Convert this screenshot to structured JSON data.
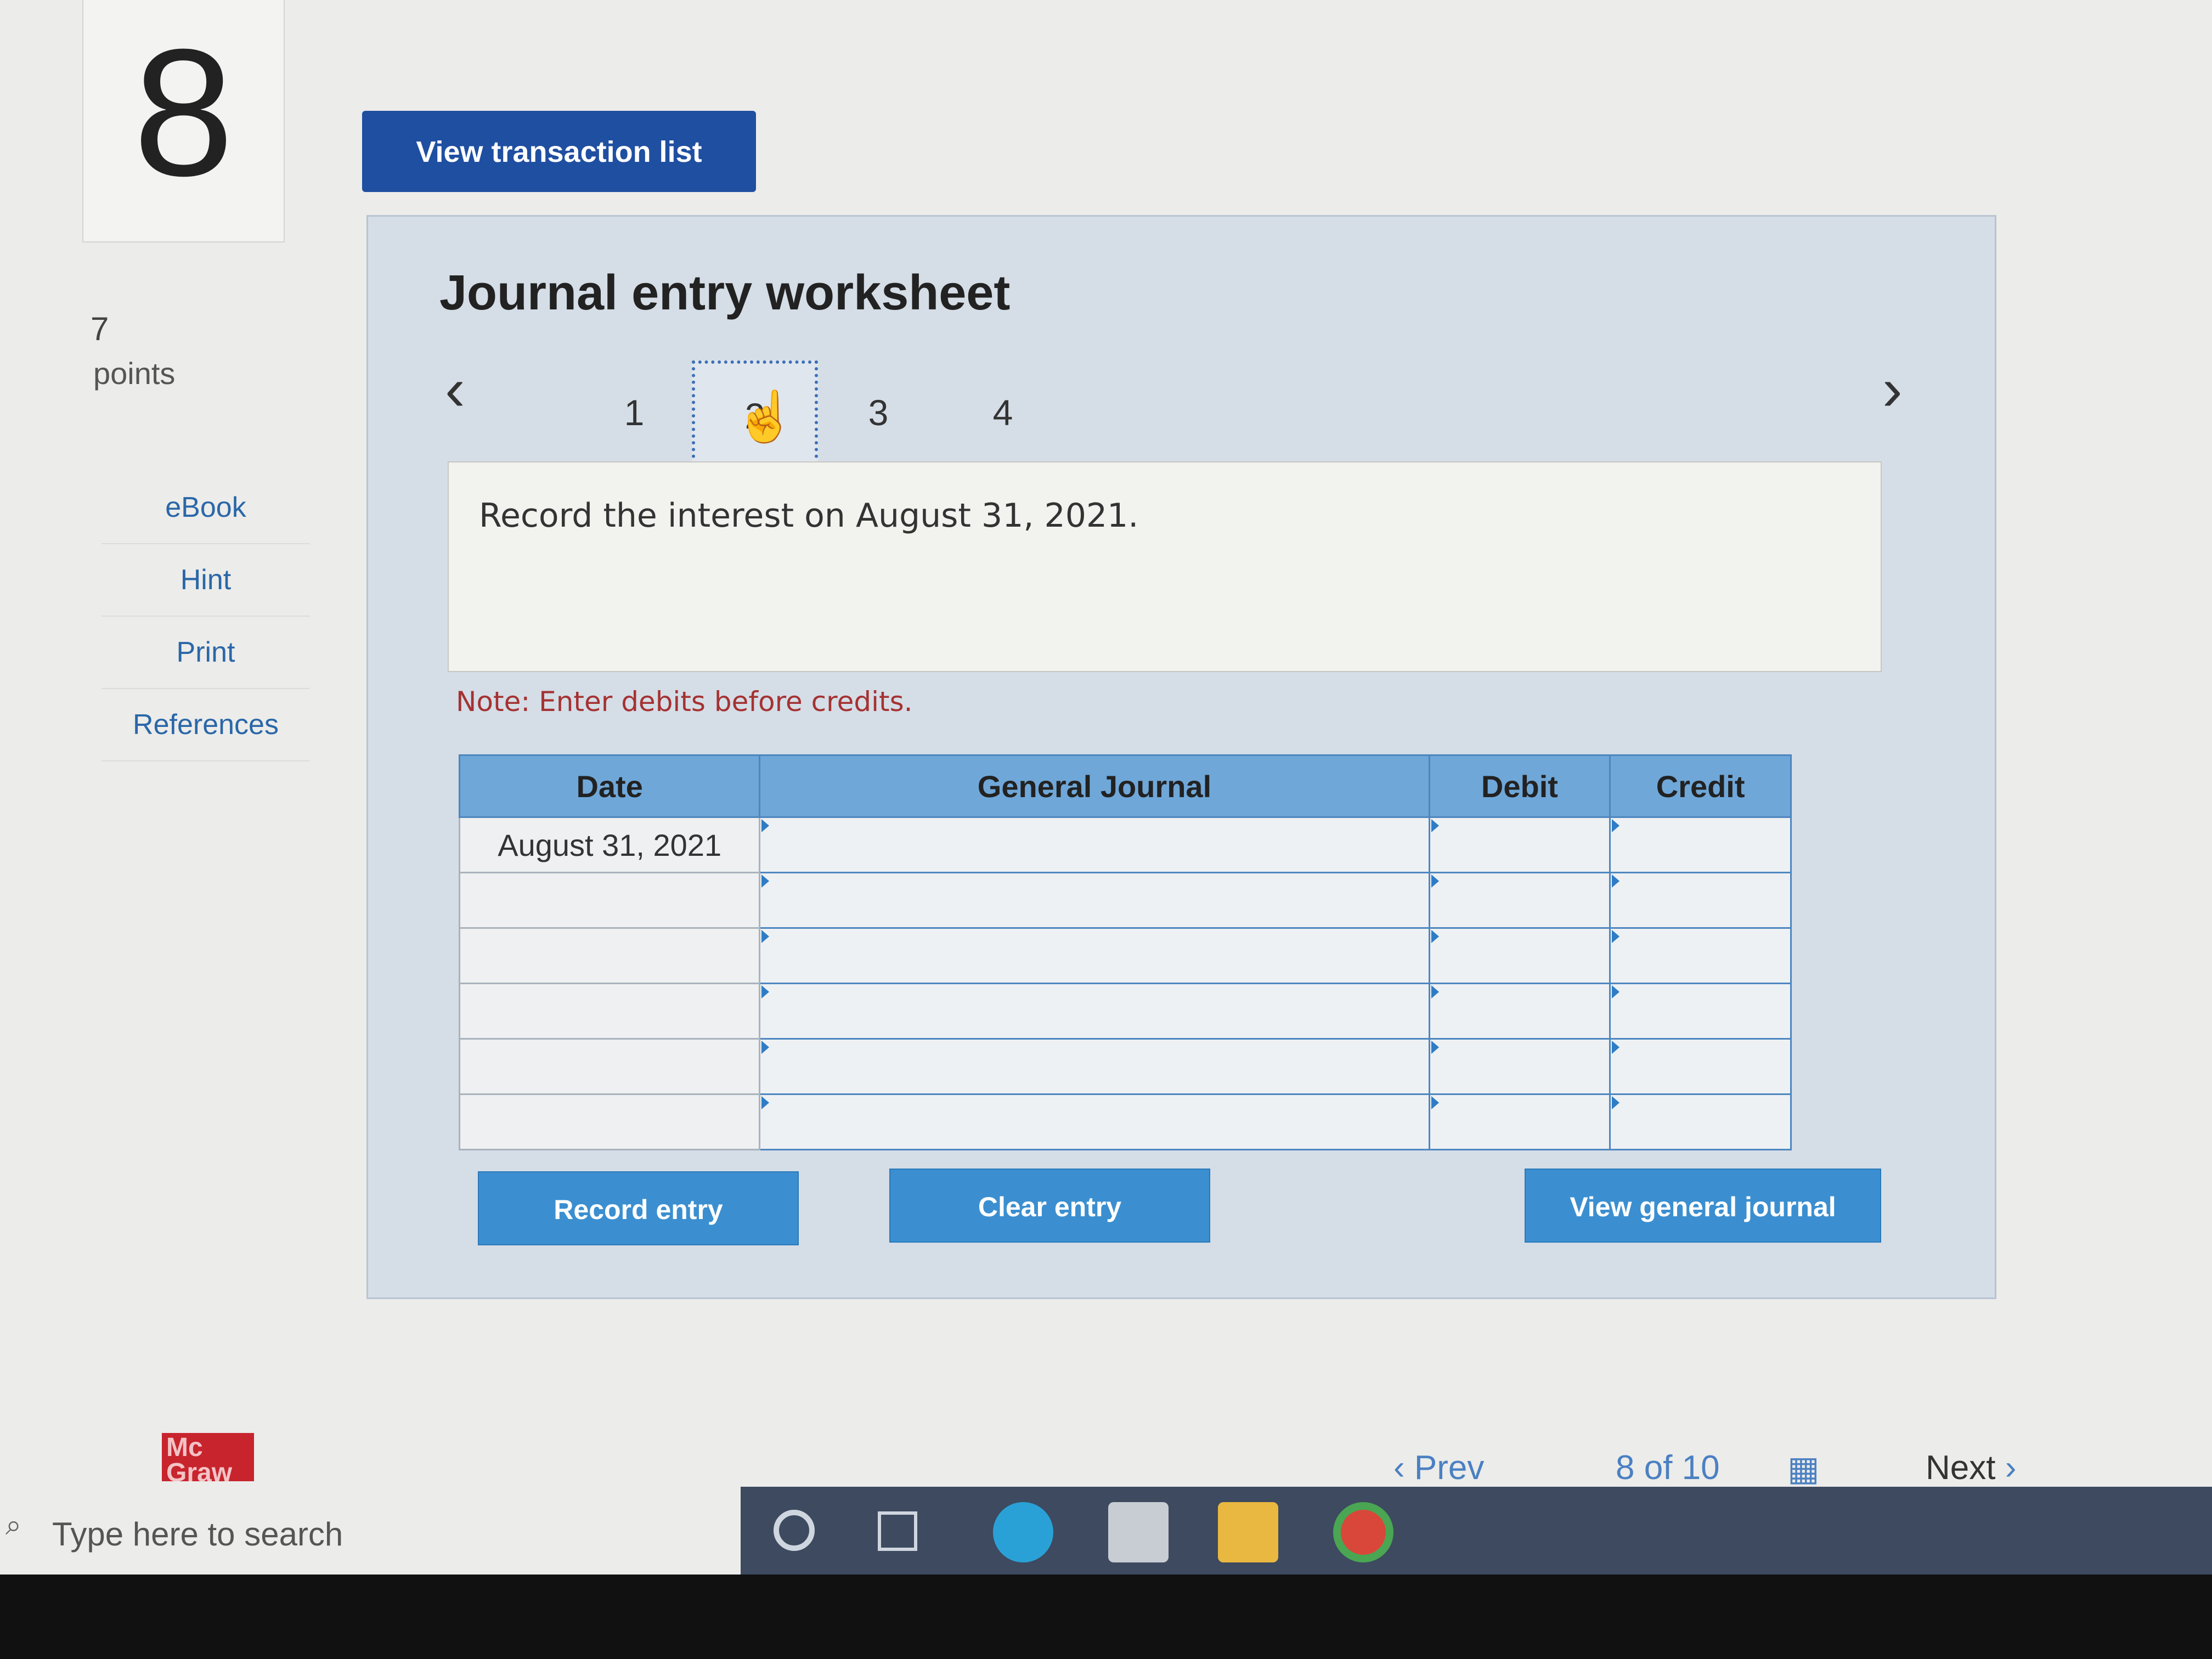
{
  "question": {
    "number": "8",
    "points_value": "7",
    "points_label": "points"
  },
  "sidebar": {
    "items": [
      {
        "label": "eBook"
      },
      {
        "label": "Hint"
      },
      {
        "label": "Print"
      },
      {
        "label": "References"
      }
    ]
  },
  "top_button": {
    "label": "View transaction list"
  },
  "worksheet": {
    "title": "Journal entry worksheet",
    "steps": [
      {
        "label": "1"
      },
      {
        "label": "2"
      },
      {
        "label": "3"
      },
      {
        "label": "4"
      }
    ],
    "active_step": "2",
    "prompt": "Record the interest on August 31, 2021.",
    "note": "Note: Enter debits before credits.",
    "table": {
      "headers": [
        "Date",
        "General Journal",
        "Debit",
        "Credit"
      ],
      "rows": [
        [
          "August 31, 2021",
          "",
          "",
          ""
        ],
        [
          "",
          "",
          "",
          ""
        ],
        [
          "",
          "",
          "",
          ""
        ],
        [
          "",
          "",
          "",
          ""
        ],
        [
          "",
          "",
          "",
          ""
        ],
        [
          "",
          "",
          "",
          ""
        ]
      ]
    },
    "buttons": {
      "record": "Record entry",
      "clear": "Clear entry",
      "view_general": "View general journal"
    }
  },
  "branding": {
    "logo_line1": "Mc",
    "logo_line2": "Graw"
  },
  "pager": {
    "prev": "Prev",
    "current": "8",
    "of": "of",
    "total": "10",
    "next": "Next"
  },
  "taskbar": {
    "search_placeholder": "Type here to search"
  },
  "colors": {
    "primary_button": "#1f4fa1",
    "action_button": "#3b8fd0",
    "table_header": "#6fa7d8",
    "note_text": "#a53232"
  }
}
